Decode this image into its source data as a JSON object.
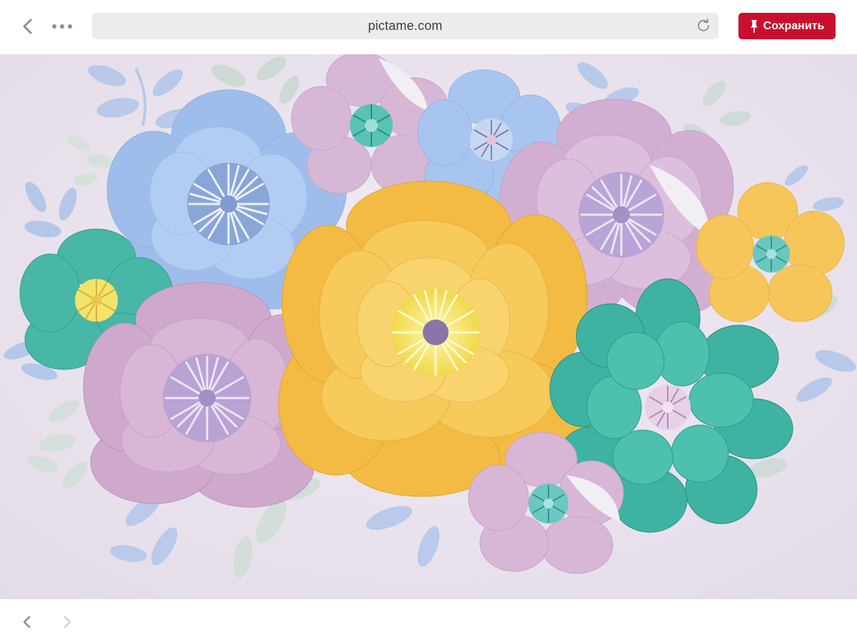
{
  "browser": {
    "address": "pictame.com",
    "save_label": "Сохранить",
    "accent_color": "#c8102e"
  },
  "icons": {
    "back": "chevron-left-icon",
    "more": "ellipsis-icon",
    "reload": "reload-icon",
    "save": "pushpin-icon",
    "nav_back": "chevron-left-icon",
    "nav_forward": "chevron-right-icon"
  },
  "image": {
    "palette": {
      "background": "#ebe5ee",
      "blue": "#a9c6ef",
      "pink": "#d9b8d6",
      "yellow": "#f6c75a",
      "teal": "#4fbfae",
      "leaf_blue": "#b8c9ea",
      "leaf_grey": "#cdd9d6"
    }
  }
}
